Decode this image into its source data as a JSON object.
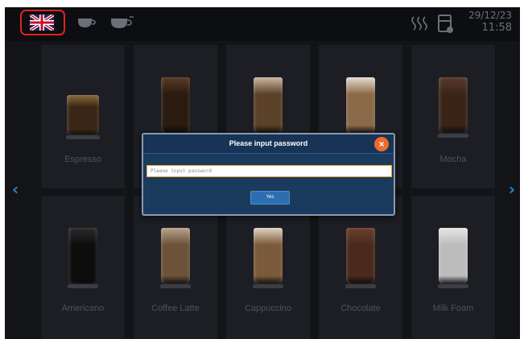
{
  "status": {
    "date": "29/12/23",
    "time": "11:58"
  },
  "icons": {
    "language": "uk-flag-icon",
    "cup1": "cup-icon",
    "cup2": "hot-cup-icon",
    "heating": "heating-icon",
    "bin": "waste-bin-icon"
  },
  "products": [
    {
      "label": "Espresso",
      "liquid": "#3a2616",
      "top": "#8a6a3c"
    },
    {
      "label": "",
      "liquid": "#2a1a10",
      "top": "#5a3a22"
    },
    {
      "label": "",
      "liquid": "#5a4128",
      "top": "#cbb7a0"
    },
    {
      "label": "",
      "liquid": "#8a6a48",
      "top": "#e8ddd0"
    },
    {
      "label": "Mocha",
      "liquid": "#3a2418",
      "top": "#5a3a2c"
    },
    {
      "label": "Americano",
      "liquid": "#0d0d0d",
      "top": "#2a2a2a"
    },
    {
      "label": "Coffee Latte",
      "liquid": "#6b5238",
      "top": "#b8a48c"
    },
    {
      "label": "Cappuccino",
      "liquid": "#7a5a3a",
      "top": "#e0d4c4"
    },
    {
      "label": "Chocolate",
      "liquid": "#4a2a1c",
      "top": "#6a4030"
    },
    {
      "label": "Milk Foam",
      "liquid": "#bcbcbc",
      "top": "#e6e6e6"
    }
  ],
  "nav": {
    "prev": "‹",
    "next": "›"
  },
  "dialog": {
    "title": "Please input password",
    "close": "×",
    "input_placeholder": "Please input password",
    "input_value": "",
    "yes_label": "Yes"
  },
  "colors": {
    "accent": "#2f83c4",
    "dialog_bg": "#1b3b5e",
    "close": "#ef6a2c",
    "input_border": "#f0a830"
  }
}
